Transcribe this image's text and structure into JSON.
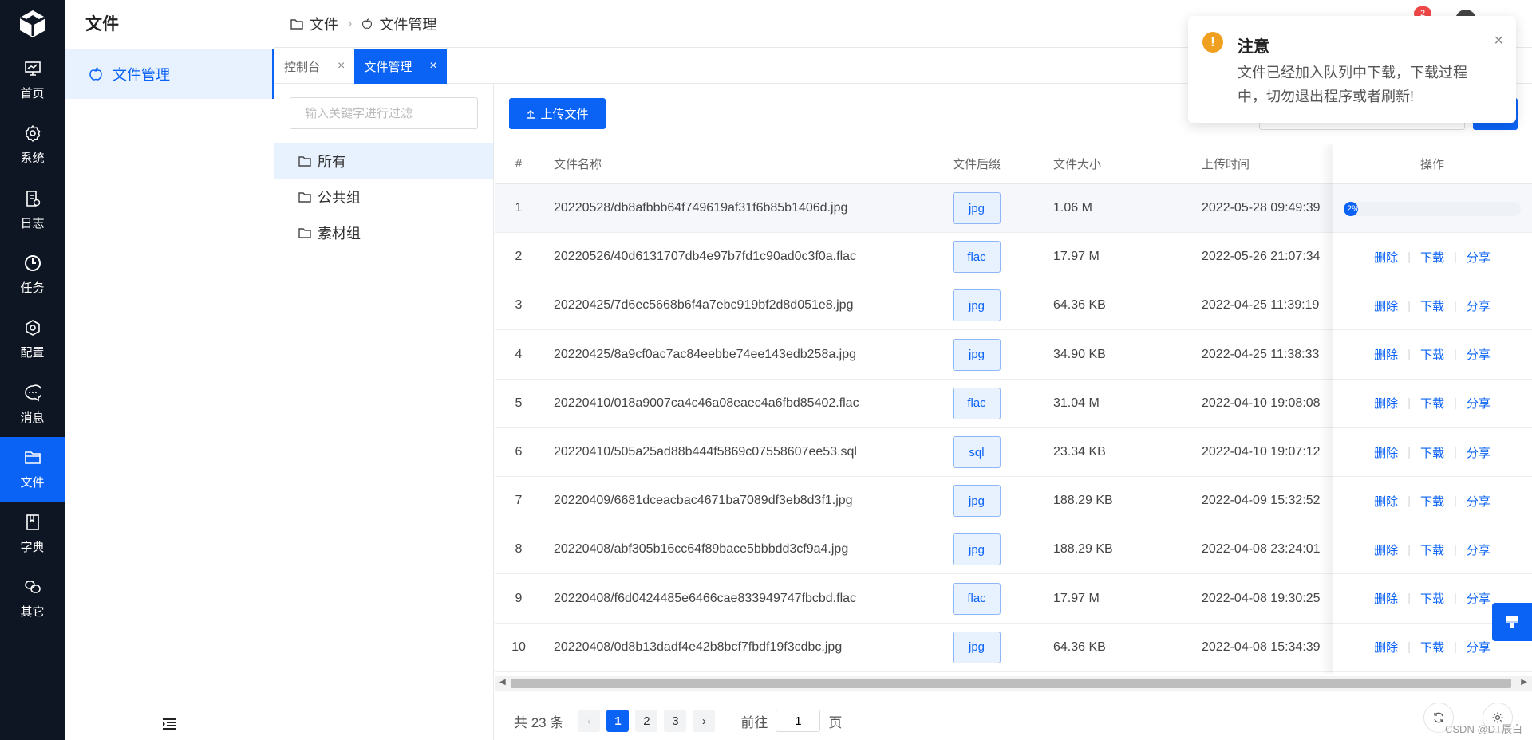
{
  "rail": {
    "items": [
      {
        "label": "首页",
        "icon": "dashboard-icon"
      },
      {
        "label": "系统",
        "icon": "gear-icon"
      },
      {
        "label": "日志",
        "icon": "log-icon"
      },
      {
        "label": "任务",
        "icon": "clock-icon"
      },
      {
        "label": "配置",
        "icon": "config-icon"
      },
      {
        "label": "消息",
        "icon": "message-icon"
      },
      {
        "label": "文件",
        "icon": "folder-icon"
      },
      {
        "label": "字典",
        "icon": "book-icon"
      },
      {
        "label": "其它",
        "icon": "link-icon"
      }
    ],
    "active": 6
  },
  "subnav": {
    "title": "文件",
    "menu": [
      {
        "label": "文件管理"
      }
    ]
  },
  "header": {
    "breadcrumb": [
      "文件",
      "文件管理"
    ],
    "notify_badge": "2"
  },
  "tabs": [
    {
      "label": "控制台",
      "active": false
    },
    {
      "label": "文件管理",
      "active": true
    }
  ],
  "tree": {
    "filter_placeholder": "输入关键字进行过滤",
    "nodes": [
      {
        "label": "所有",
        "selected": true
      },
      {
        "label": "公共组",
        "selected": false
      },
      {
        "label": "素材组",
        "selected": false
      }
    ]
  },
  "toolbar": {
    "upload_label": "上传文件"
  },
  "table": {
    "columns": {
      "no": "#",
      "name": "文件名称",
      "ext": "文件后缀",
      "size": "文件大小",
      "time": "上传时间",
      "op": "操作"
    },
    "rows": [
      {
        "no": "1",
        "name": "20220528/db8afbbb64f749619af31f6b85b1406d.jpg",
        "ext": "jpg",
        "size": "1.06 M",
        "time": "2022-05-28 09:49:39"
      },
      {
        "no": "2",
        "name": "20220526/40d6131707db4e97b7fd1c90ad0c3f0a.flac",
        "ext": "flac",
        "size": "17.97 M",
        "time": "2022-05-26 21:07:34"
      },
      {
        "no": "3",
        "name": "20220425/7d6ec5668b6f4a7ebc919bf2d8d051e8.jpg",
        "ext": "jpg",
        "size": "64.36 KB",
        "time": "2022-04-25 11:39:19"
      },
      {
        "no": "4",
        "name": "20220425/8a9cf0ac7ac84eebbe74ee143edb258a.jpg",
        "ext": "jpg",
        "size": "34.90 KB",
        "time": "2022-04-25 11:38:33"
      },
      {
        "no": "5",
        "name": "20220410/018a9007ca4c46a08eaec4a6fbd85402.flac",
        "ext": "flac",
        "size": "31.04 M",
        "time": "2022-04-10 19:08:08"
      },
      {
        "no": "6",
        "name": "20220410/505a25ad88b444f5869c07558607ee53.sql",
        "ext": "sql",
        "size": "23.34 KB",
        "time": "2022-04-10 19:07:12"
      },
      {
        "no": "7",
        "name": "20220409/6681dceacbac4671ba7089df3eb8d3f1.jpg",
        "ext": "jpg",
        "size": "188.29 KB",
        "time": "2022-04-09 15:32:52"
      },
      {
        "no": "8",
        "name": "20220408/abf305b16cc64f89bace5bbbdd3cf9a4.jpg",
        "ext": "jpg",
        "size": "188.29 KB",
        "time": "2022-04-08 23:24:01"
      },
      {
        "no": "9",
        "name": "20220408/f6d0424485e6466cae833949747fbcbd.flac",
        "ext": "flac",
        "size": "17.97 M",
        "time": "2022-04-08 19:30:25"
      },
      {
        "no": "10",
        "name": "20220408/0d8b13dadf4e42b8bcf7fbdf19f3cdbc.jpg",
        "ext": "jpg",
        "size": "64.36 KB",
        "time": "2022-04-08 15:34:39"
      }
    ],
    "actions": {
      "delete": "删除",
      "download": "下载",
      "share": "分享"
    },
    "download_progress": {
      "row": 1,
      "text": "2%",
      "percent": 2
    }
  },
  "pager": {
    "total": "共 23 条",
    "pages": [
      "1",
      "2",
      "3"
    ],
    "current": "1",
    "goto_prefix": "前往",
    "goto_value": "1",
    "goto_suffix": "页"
  },
  "toast": {
    "title": "注意",
    "body": "文件已经加入队列中下载，下载过程中，切勿退出程序或者刷新!",
    "close": "×"
  },
  "watermark": "CSDN @DT辰白",
  "colors": {
    "primary": "#0b63f6",
    "rail_bg": "#0f1623",
    "warning": "#f0a020"
  }
}
